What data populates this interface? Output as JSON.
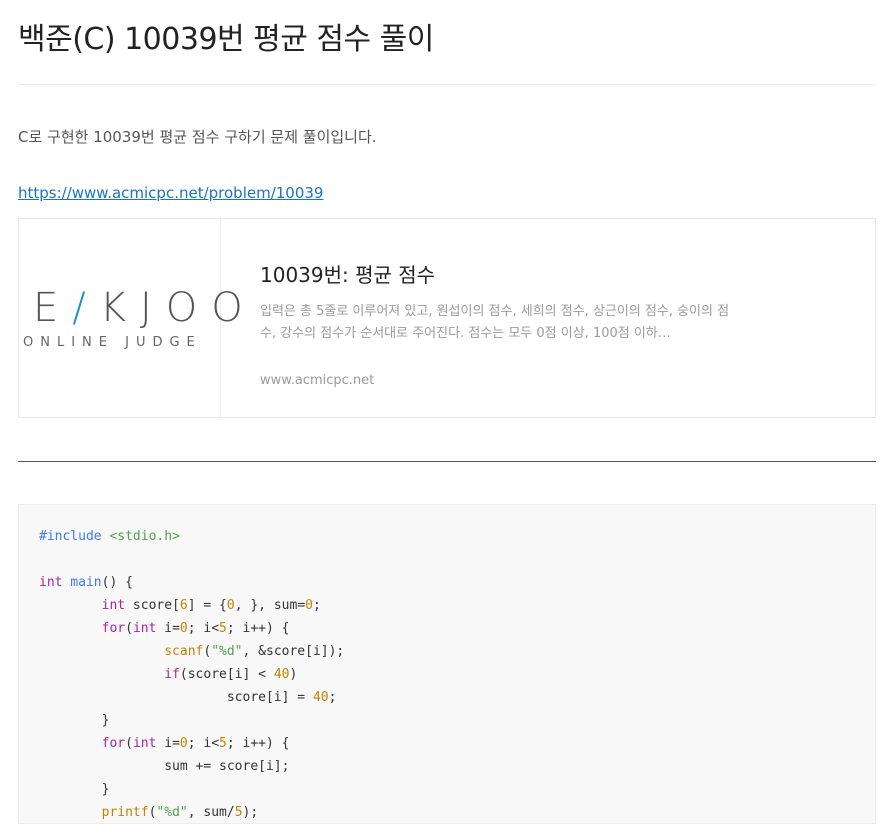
{
  "post": {
    "title": "백준(C) 10039번 평균 점수 풀이",
    "intro": "C로 구현한 10039번 평균 점수 구하기 문제 풀이입니다.",
    "link": "https://www.acmicpc.net/problem/10039"
  },
  "card": {
    "logo_main": "EKJOO",
    "logo_sub": "ONLINE JUDGE",
    "title": "10039번: 평균 점수",
    "description": "입력은 총 5줄로 이루어져 있고, 원섭이의 점수, 세희의 점수, 상근이의 점수, 숭이의 점수, 강수의 점수가 순서대로 주어진다. 점수는 모두 0점 이상, 100점 이하…",
    "domain": "www.acmicpc.net"
  },
  "code": {
    "lines": [
      "#include <stdio.h>",
      "",
      "int main() {",
      "        int score[6] = {0, }, sum=0;",
      "        for(int i=0; i<5; i++) {",
      "                scanf(\"%d\", &score[i]);",
      "                if(score[i] < 40)",
      "                        score[i] = 40;",
      "        }",
      "        for(int i=0; i<5; i++) {",
      "                sum += score[i];",
      "        }",
      "        printf(\"%d\", sum/5);"
    ]
  }
}
